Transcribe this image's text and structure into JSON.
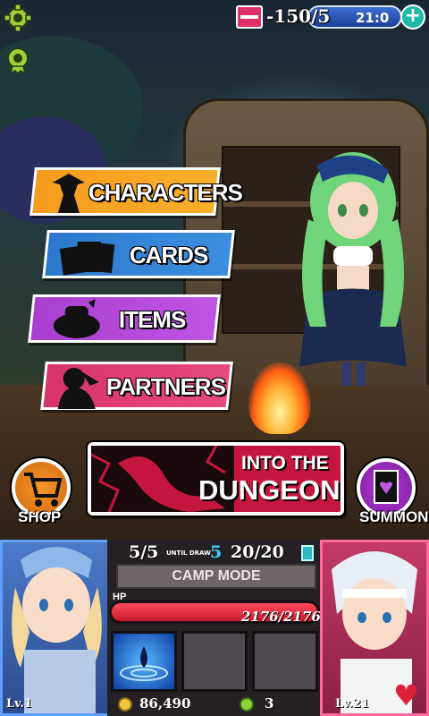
{
  "top_bar": {
    "stamina_value": "-150",
    "stamina_max": "5",
    "timer": "21:0",
    "plus_label": "+"
  },
  "menu": {
    "characters": "CHARACTERS",
    "cards": "CARDS",
    "items": "ITEMS",
    "partners": "PARTNERS"
  },
  "actions": {
    "dungeon_line1": "INTO THE",
    "dungeon_line2": "DUNGEON",
    "shop": "SHOP",
    "summon": "SUMMON"
  },
  "status": {
    "hand": "5/5",
    "until_draw_label": "UNTIL DRAW",
    "until_draw_value": "5",
    "deck": "20/20",
    "mode": "CAMP MODE",
    "hp_label": "HP",
    "hp_text": "2176/2176",
    "hp_fraction": 1.0
  },
  "resources": {
    "gold": "86,490",
    "gems": "3"
  },
  "party": {
    "left_level": "Lv.1",
    "right_level": "Lv.21"
  },
  "colors": {
    "characters": "#f79a1e",
    "cards": "#2d78cc",
    "items": "#a93fd1",
    "partners": "#d8336b",
    "dungeon": "#c5163f"
  },
  "icons": [
    "settings-gear-icon",
    "achievement-badge-icon",
    "stamina-card-icon",
    "plus-icon",
    "heart-icon",
    "gold-coin-icon",
    "gem-icon",
    "deck-icon",
    "water-skill-icon",
    "shopping-cart-icon",
    "summon-card-icon"
  ]
}
